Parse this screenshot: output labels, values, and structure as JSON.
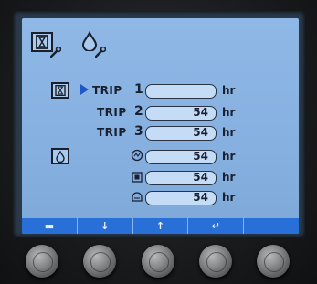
{
  "header_icons": [
    "hourglass-service-icon",
    "oil-drop-service-icon"
  ],
  "trip": {
    "label": "TRIP",
    "rows": [
      {
        "number": "1",
        "value": "",
        "unit": "hr",
        "selected": true
      },
      {
        "number": "2",
        "value": "54",
        "unit": "hr",
        "selected": false
      },
      {
        "number": "3",
        "value": "54",
        "unit": "hr",
        "selected": false
      }
    ]
  },
  "oil": {
    "rows": [
      {
        "icon": "engine-oil-icon",
        "value": "54",
        "unit": "hr"
      },
      {
        "icon": "oil-filter-icon",
        "value": "54",
        "unit": "hr"
      },
      {
        "icon": "hydraulic-oil-icon",
        "value": "54",
        "unit": "hr"
      }
    ]
  },
  "softkeys": [
    {
      "icon": "keyboard-icon",
      "glyph": "▬"
    },
    {
      "icon": "down-arrow-icon",
      "glyph": "↓"
    },
    {
      "icon": "up-arrow-icon",
      "glyph": "↑"
    },
    {
      "icon": "enter-icon",
      "glyph": "↵"
    },
    {
      "icon": "blank",
      "glyph": ""
    }
  ],
  "colors": {
    "screen": "#8fb8e6",
    "accent": "#1e57c8",
    "softbar": "#2870d8"
  }
}
